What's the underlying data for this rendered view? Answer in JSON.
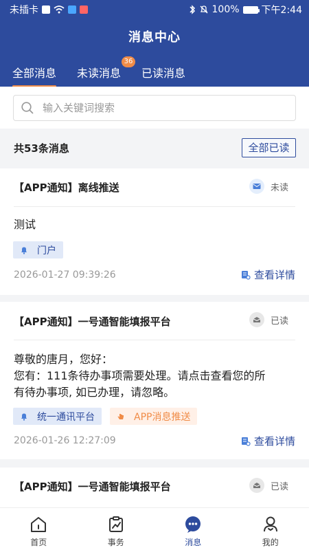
{
  "status_bar": {
    "carrier": "未插卡",
    "battery": "100%",
    "time": "下午2:44"
  },
  "header": {
    "title": "消息中心",
    "tabs": [
      {
        "label": "全部消息",
        "active": true
      },
      {
        "label": "未读消息",
        "badge": "36"
      },
      {
        "label": "已读消息"
      }
    ]
  },
  "search": {
    "placeholder": "输入关键词搜索",
    "value": ""
  },
  "list": {
    "count_text": "共53条消息",
    "all_read_label": "全部已读"
  },
  "messages": [
    {
      "title": "【APP通知】离线推送",
      "status": "未读",
      "content_lines": [
        "测试"
      ],
      "tags": [
        {
          "label": "门户",
          "color": "blue"
        }
      ],
      "time": "2026-01-27 09:39:26",
      "detail_label": "查看详情"
    },
    {
      "title": "【APP通知】一号通智能填报平台",
      "status": "已读",
      "content_lines": [
        "尊敬的唐月，您好：",
        "您有：111条待办事项需要处理。请点击查看您的所",
        "有待办事项, 如已办理，请忽略。"
      ],
      "tags": [
        {
          "label": "统一通讯平台",
          "color": "blue"
        },
        {
          "label": "APP消息推送",
          "color": "orange"
        }
      ],
      "time": "2026-01-26 12:27:09",
      "detail_label": "查看详情"
    },
    {
      "title": "【APP通知】一号通智能填报平台",
      "status": "已读"
    }
  ],
  "bottom_nav": [
    {
      "label": "首页",
      "icon": "home-icon"
    },
    {
      "label": "事务",
      "icon": "chart-icon"
    },
    {
      "label": "消息",
      "icon": "chat-icon",
      "active": true
    },
    {
      "label": "我的",
      "icon": "user-icon"
    }
  ],
  "colors": {
    "primary": "#2d4b9d",
    "accent": "#f08c48"
  }
}
